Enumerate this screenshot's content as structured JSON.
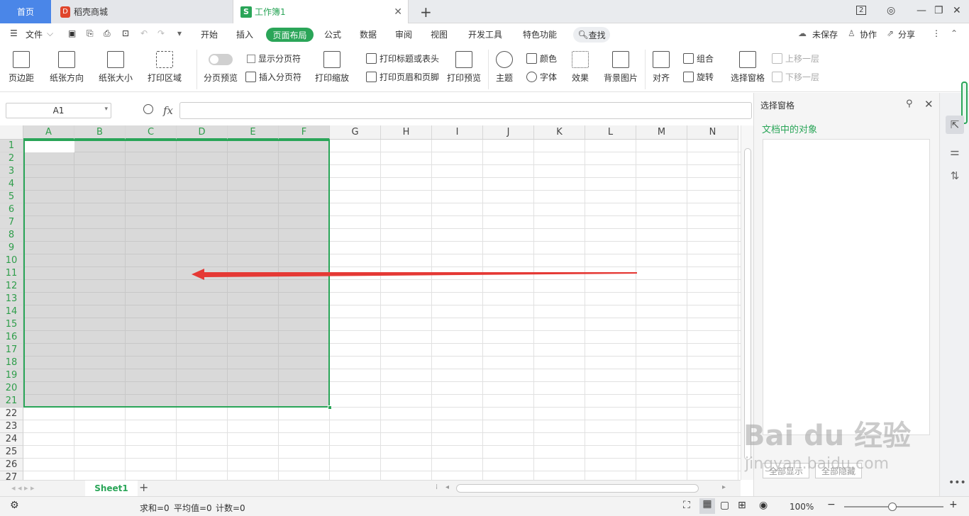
{
  "tabs": {
    "home": "首页",
    "store": "稻壳商城",
    "book": "工作簿1",
    "book_icon": "S",
    "store_icon": "D"
  },
  "menu": {
    "file": "文件",
    "items": [
      "开始",
      "插入",
      "页面布局",
      "公式",
      "数据",
      "审阅",
      "视图",
      "开发工具",
      "特色功能"
    ],
    "active": "页面布局",
    "find": "查找",
    "unsaved": "未保存",
    "collab": "协作",
    "share": "分享"
  },
  "ribbon": {
    "margins": "页边距",
    "orientation": "纸张方向",
    "size": "纸张大小",
    "print_area": "打印区域",
    "page_break_preview": "分页预览",
    "show_page_breaks": "显示分页符",
    "insert_page_break": "插入分页符",
    "print_scale": "打印缩放",
    "print_titles": "打印标题或表头",
    "header_footer": "打印页眉和页脚",
    "print_preview": "打印预览",
    "theme": "主题",
    "colors": "颜色",
    "fonts": "字体",
    "effects": "效果",
    "bg_image": "背景图片",
    "align": "对齐",
    "group": "组合",
    "rotate": "旋转",
    "selection_pane": "选择窗格",
    "bring_forward": "上移一层",
    "send_backward": "下移一层"
  },
  "formula": {
    "cell_ref": "A1",
    "fx": "fx",
    "value": ""
  },
  "columns": [
    "A",
    "B",
    "C",
    "D",
    "E",
    "F",
    "G",
    "H",
    "I",
    "J",
    "K",
    "L",
    "M",
    "N"
  ],
  "rows": [
    "1",
    "2",
    "3",
    "4",
    "5",
    "6",
    "7",
    "8",
    "9",
    "10",
    "11",
    "12",
    "13",
    "14",
    "15",
    "16",
    "17",
    "18",
    "19",
    "20",
    "21",
    "22",
    "23",
    "24",
    "25",
    "26",
    "27"
  ],
  "selection": {
    "range": "A1:F21",
    "color": "#2aa558"
  },
  "sheet": {
    "name": "Sheet1"
  },
  "status": {
    "sum": "求和=0",
    "avg": "平均值=0",
    "count": "计数=0",
    "zoom": "100%"
  },
  "panel": {
    "title": "选择窗格",
    "label": "文档中的对象",
    "show_all": "全部显示",
    "hide_all": "全部隐藏"
  },
  "watermark": {
    "brand": "Bai du 经验",
    "url": "jingyan.baidu.com"
  }
}
